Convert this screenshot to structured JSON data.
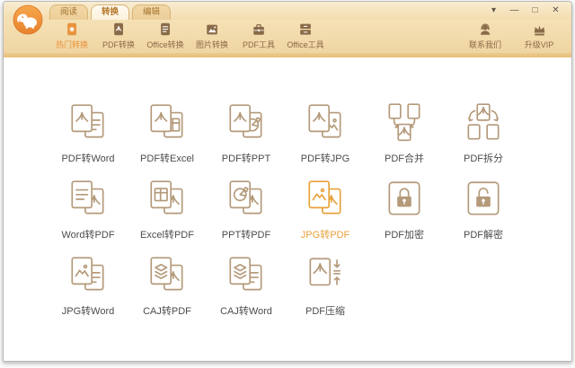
{
  "window": {
    "tabs": [
      {
        "id": "read",
        "label": "阅读",
        "active": false
      },
      {
        "id": "convert",
        "label": "转换",
        "active": true
      },
      {
        "id": "edit",
        "label": "编辑",
        "active": false
      }
    ],
    "controls": [
      {
        "id": "skin-menu",
        "glyph": "▾",
        "icon_name": "chevron-down-icon"
      },
      {
        "id": "minimize",
        "glyph": "—",
        "icon_name": "minimize-icon"
      },
      {
        "id": "maximize",
        "glyph": "□",
        "icon_name": "maximize-icon"
      },
      {
        "id": "close",
        "glyph": "✕",
        "icon_name": "close-icon"
      }
    ]
  },
  "logo": {
    "icon_name": "elephant-mascot-icon"
  },
  "toolbar": {
    "items": [
      {
        "id": "hot-convert",
        "label": "热门转换",
        "icon": "doc-star",
        "active": true
      },
      {
        "id": "pdf-convert",
        "label": "PDF转换",
        "icon": "doc-pdf",
        "active": false
      },
      {
        "id": "office-convert",
        "label": "Office转换",
        "icon": "doc-lines",
        "active": false
      },
      {
        "id": "image-convert",
        "label": "图片转换",
        "icon": "image",
        "active": false
      },
      {
        "id": "pdf-tools",
        "label": "PDF工具",
        "icon": "briefcase",
        "active": false
      },
      {
        "id": "office-tools",
        "label": "Office工具",
        "icon": "drawers",
        "active": false
      }
    ],
    "right_items": [
      {
        "id": "contact-us",
        "label": "联系我们",
        "icon": "headset"
      },
      {
        "id": "upgrade-vip",
        "label": "升级VIP",
        "icon": "crown"
      }
    ]
  },
  "grid": {
    "items": [
      {
        "id": "pdf-to-word",
        "label": "PDF转Word",
        "icon": "pair-pdf-lines",
        "highlighted": false
      },
      {
        "id": "pdf-to-excel",
        "label": "PDF转Excel",
        "icon": "pair-pdf-grid",
        "highlighted": false
      },
      {
        "id": "pdf-to-ppt",
        "label": "PDF转PPT",
        "icon": "pair-pdf-pie",
        "highlighted": false
      },
      {
        "id": "pdf-to-jpg",
        "label": "PDF转JPG",
        "icon": "pair-pdf-image",
        "highlighted": false
      },
      {
        "id": "pdf-merge",
        "label": "PDF合并",
        "icon": "merge",
        "highlighted": false
      },
      {
        "id": "pdf-split",
        "label": "PDF拆分",
        "icon": "split",
        "highlighted": false
      },
      {
        "id": "word-to-pdf",
        "label": "Word转PDF",
        "icon": "pair-lines-pdf",
        "highlighted": false
      },
      {
        "id": "excel-to-pdf",
        "label": "Excel转PDF",
        "icon": "pair-grid-pdf",
        "highlighted": false
      },
      {
        "id": "ppt-to-pdf",
        "label": "PPT转PDF",
        "icon": "pair-pie-pdf",
        "highlighted": false
      },
      {
        "id": "jpg-to-pdf",
        "label": "JPG转PDF",
        "icon": "pair-image-pdf",
        "highlighted": true
      },
      {
        "id": "pdf-encrypt",
        "label": "PDF加密",
        "icon": "lock-closed",
        "highlighted": false
      },
      {
        "id": "pdf-decrypt",
        "label": "PDF解密",
        "icon": "lock-open",
        "highlighted": false
      },
      {
        "id": "jpg-to-word",
        "label": "JPG转Word",
        "icon": "pair-image-lines",
        "highlighted": false
      },
      {
        "id": "caj-to-pdf",
        "label": "CAJ转PDF",
        "icon": "pair-layers-pdf",
        "highlighted": false
      },
      {
        "id": "caj-to-word",
        "label": "CAJ转Word",
        "icon": "pair-layers-lines",
        "highlighted": false
      },
      {
        "id": "pdf-compress",
        "label": "PDF压缩",
        "icon": "compress",
        "highlighted": false
      }
    ]
  },
  "colors": {
    "accent_orange": "#e8933c",
    "highlight_orange": "#e8a23b",
    "icon_stroke": "#b49a7a",
    "toolbar_brown": "#8a6b49",
    "titlebar_bg": "#f4ddae",
    "edge_band": "#e5bf7c",
    "label_gray": "#4c4c4c"
  }
}
